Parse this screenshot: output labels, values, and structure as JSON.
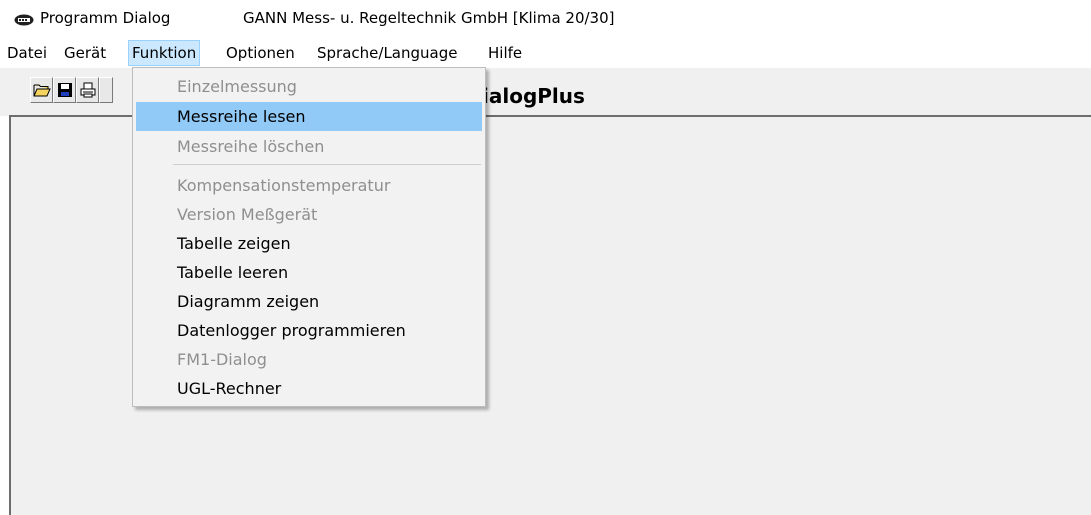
{
  "window": {
    "app_title": "Programm Dialog",
    "document_title": "GANN Mess- u. Regeltechnik GmbH [Klima 20/30]",
    "icon": "gann-app-icon"
  },
  "menubar": {
    "items": [
      {
        "label": "Datei"
      },
      {
        "label": "Gerät"
      },
      {
        "label": "Funktion",
        "open": true
      },
      {
        "label": "Optionen"
      },
      {
        "label": "Sprache/Language"
      },
      {
        "label": "Hilfe"
      }
    ]
  },
  "toolbar": {
    "buttons": [
      {
        "icon": "open-folder-icon"
      },
      {
        "icon": "save-disk-icon"
      },
      {
        "icon": "print-icon"
      }
    ],
    "header_title": "ialogPlus"
  },
  "funktion_menu": {
    "items": [
      {
        "label": "Einzelmessung",
        "enabled": false
      },
      {
        "label": "Messreihe lesen",
        "enabled": true,
        "highlighted": true
      },
      {
        "label": "Messreihe löschen",
        "enabled": false
      },
      {
        "label": "Kompensationstemperatur",
        "enabled": false
      },
      {
        "label": "Version Meßgerät",
        "enabled": false
      },
      {
        "label": "Tabelle zeigen",
        "enabled": true
      },
      {
        "label": "Tabelle leeren",
        "enabled": true
      },
      {
        "label": "Diagramm zeigen",
        "enabled": true
      },
      {
        "label": "Datenlogger programmieren",
        "enabled": true
      },
      {
        "label": "FM1-Dialog",
        "enabled": false
      },
      {
        "label": "UGL-Rechner",
        "enabled": true
      }
    ]
  },
  "colors": {
    "menu_highlight": "#91c9f7",
    "menubar_open": "#cce8ff",
    "disabled_text": "#8f8f8f"
  }
}
